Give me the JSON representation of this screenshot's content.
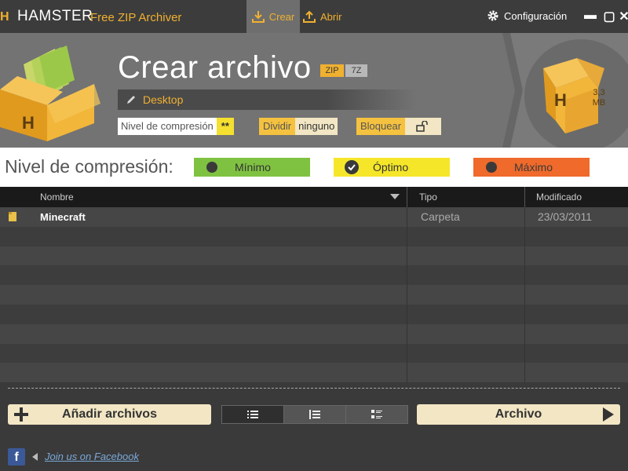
{
  "app": {
    "logo_mark": "H",
    "name": "HAMSTER",
    "subtitle": "Free ZIP Archiver"
  },
  "tabs": [
    {
      "label": "Crear",
      "icon": "download-icon",
      "active": true
    },
    {
      "label": "Abrir",
      "icon": "upload-icon",
      "active": false
    }
  ],
  "settings_label": "Configuración",
  "window_controls": {
    "minimize": "▬",
    "maximize": "▢",
    "close": "✕"
  },
  "header": {
    "title": "Crear archivo",
    "formats": {
      "zip": "ZIP",
      "sevenz": "7Z"
    },
    "destination": "Desktop",
    "options": {
      "compression_label": "Nivel de compresión",
      "compression_value": "**",
      "split_label": "Dividir",
      "split_value": "ninguno",
      "lock_label": "Bloquear"
    },
    "box_letter": "H",
    "archive_size": "3,3",
    "archive_size_unit": "MB"
  },
  "compression": {
    "label": "Nivel de compresión:",
    "levels": [
      {
        "name": "Mínimo",
        "color": "#7fc241",
        "selected": false
      },
      {
        "name": "Óptimo",
        "color": "#f5e62a",
        "selected": true
      },
      {
        "name": "Máximo",
        "color": "#ef6a2b",
        "selected": false
      }
    ]
  },
  "table": {
    "columns": [
      "Nombre",
      "Tipo",
      "Modificado"
    ],
    "rows": [
      {
        "name": "Minecraft",
        "type": "Carpeta",
        "modified": "23/03/2011"
      }
    ]
  },
  "bottom": {
    "add_label": "Añadir archivos",
    "archive_label": "Archivo",
    "view_modes": [
      "list-view-icon",
      "detail-view-icon",
      "tile-view-icon"
    ]
  },
  "footer": {
    "link": "Join us on Facebook",
    "facebook_mark": "f"
  },
  "colors": {
    "accent": "#f0b030",
    "background": "#3a3a3a",
    "header": "#737373"
  }
}
